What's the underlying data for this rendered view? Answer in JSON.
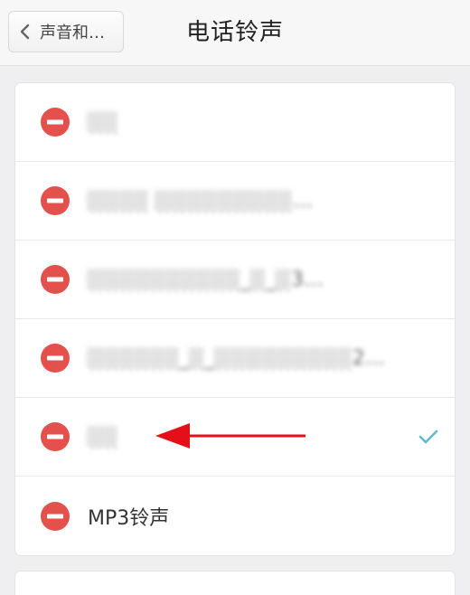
{
  "navbar": {
    "back_label": "声音和…",
    "title": "电话铃声"
  },
  "ringtones": [
    {
      "label": "░░",
      "blurred": true,
      "selected": false
    },
    {
      "label": "░░░░ ░░░░░░░░░…",
      "blurred": true,
      "selected": false
    },
    {
      "label": "░░░░░░░░░░_░_░3…",
      "blurred": true,
      "selected": false
    },
    {
      "label": "░░░░░░_░_░░░░░░░░░2…",
      "blurred": true,
      "selected": false
    },
    {
      "label": "░░",
      "blurred": true,
      "selected": true
    },
    {
      "label": "MP3铃声",
      "blurred": false,
      "selected": false
    }
  ],
  "colors": {
    "delete_red": "#e4504b",
    "check_teal": "#5fbcc6",
    "annotation_arrow": "#e3101a"
  },
  "icons": {
    "back": "chevron-left-icon",
    "delete": "minus-circle-icon",
    "selected": "checkmark-icon"
  }
}
